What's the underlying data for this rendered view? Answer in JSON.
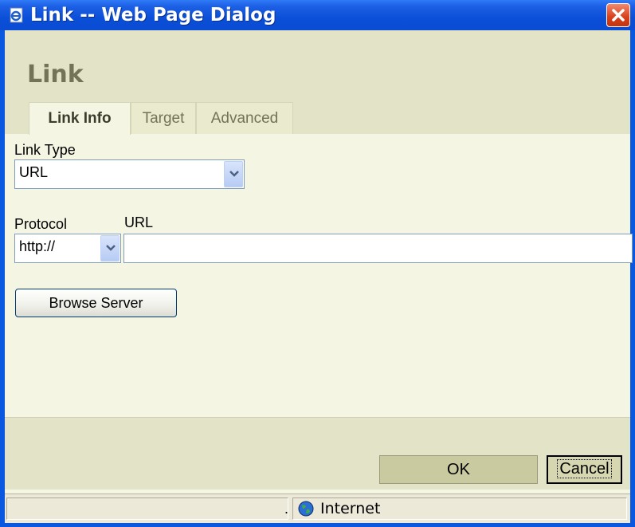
{
  "window": {
    "title": "Link -- Web Page Dialog"
  },
  "dialog": {
    "title": "Link",
    "tabs": [
      {
        "label": "Link Info",
        "active": true
      },
      {
        "label": "Target",
        "active": false
      },
      {
        "label": "Advanced",
        "active": false
      }
    ],
    "link_type": {
      "label": "Link Type",
      "value": "URL"
    },
    "protocol": {
      "label": "Protocol",
      "value": "http://"
    },
    "url": {
      "label": "URL",
      "value": ""
    },
    "browse_label": "Browse Server",
    "ok_label": "OK",
    "cancel_label": "Cancel"
  },
  "statusbar": {
    "separator": ".",
    "zone": "Internet"
  },
  "colors": {
    "titlebar": "#0a4cd2",
    "client_bg": "#f5f5e4",
    "band_bg": "#e3e3c7",
    "close": "#d8401c"
  }
}
